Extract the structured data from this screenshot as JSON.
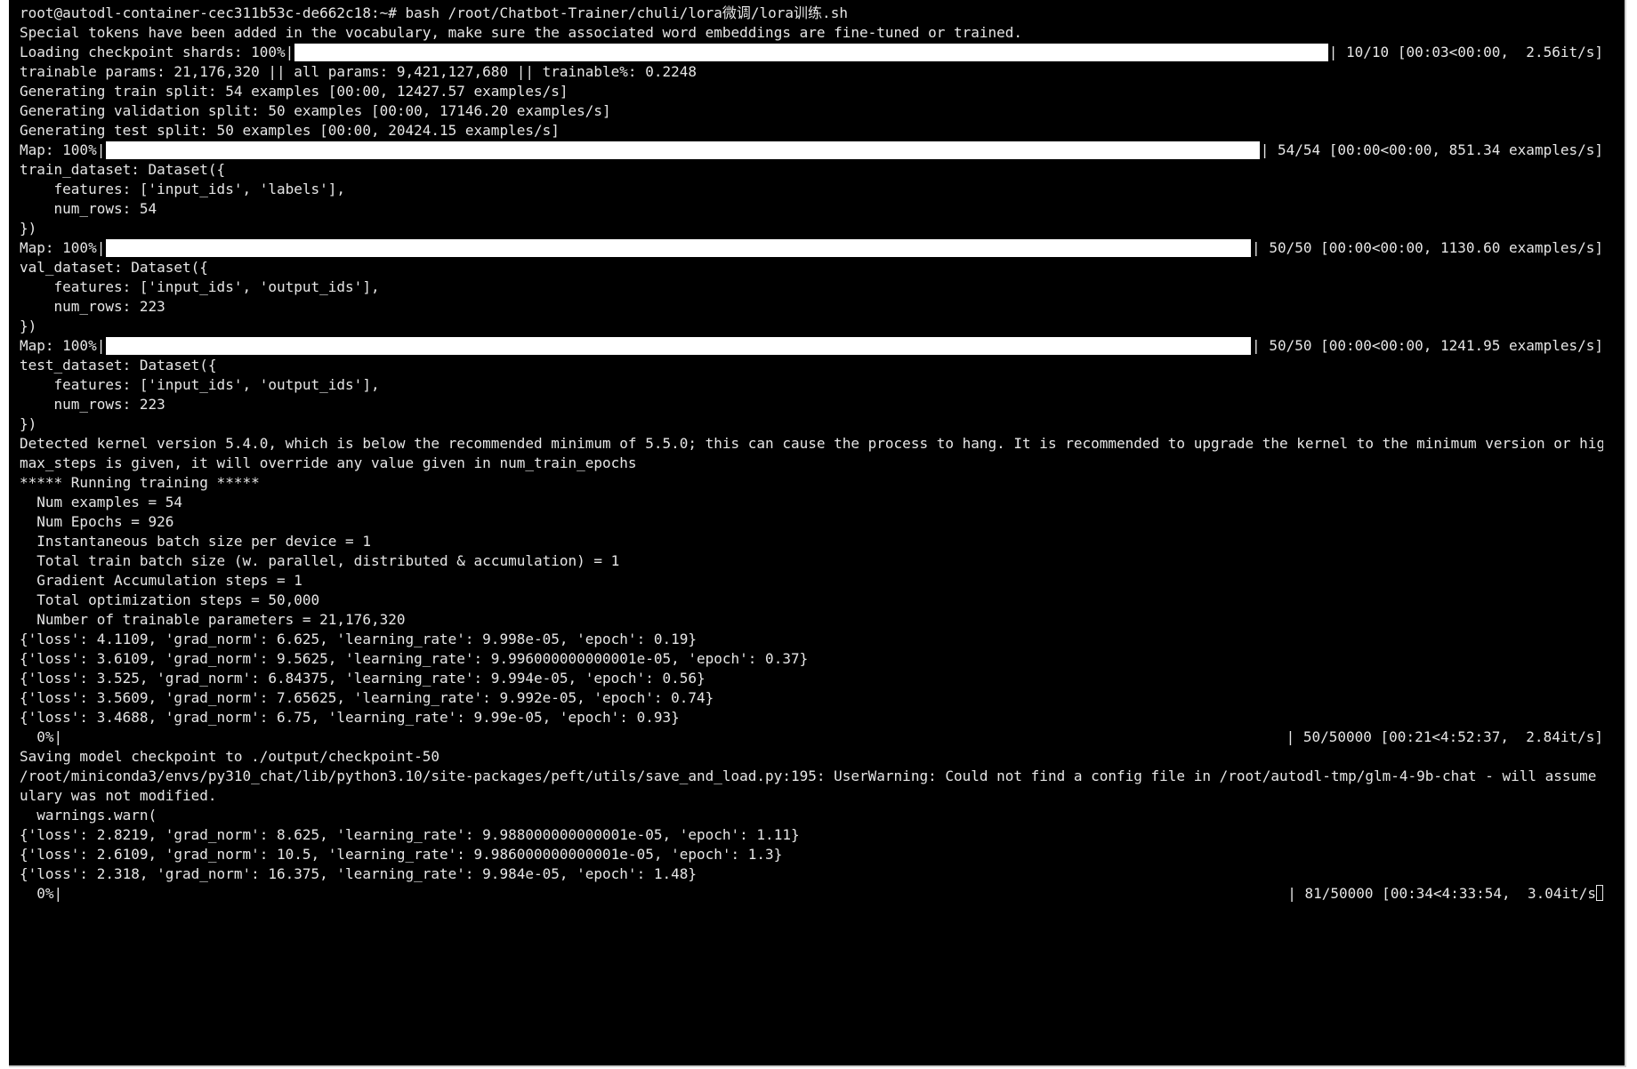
{
  "prompt": "root@autodl-container-cec311b53c-de662c18:~# bash /root/Chatbot-Trainer/chuli/lora微调/lora训练.sh",
  "lines_a": [
    "Special tokens have been added in the vocabulary, make sure the associated word embeddings are fine-tuned or trained."
  ],
  "progress_shards": {
    "prefix": "Loading checkpoint shards: 100%|",
    "fill": 1.0,
    "suffix": "| 10/10 [00:03<00:00,  2.56it/s]"
  },
  "lines_b": [
    "trainable params: 21,176,320 || all params: 9,421,127,680 || trainable%: 0.2248",
    "Generating train split: 54 examples [00:00, 12427.57 examples/s]",
    "Generating validation split: 50 examples [00:00, 17146.20 examples/s]",
    "Generating test split: 50 examples [00:00, 20424.15 examples/s]"
  ],
  "progress_map1": {
    "prefix": "Map: 100%|",
    "fill": 1.0,
    "suffix": "| 54/54 [00:00<00:00, 851.34 examples/s]"
  },
  "lines_c": [
    "train_dataset: Dataset({",
    "    features: ['input_ids', 'labels'],",
    "    num_rows: 54",
    "})"
  ],
  "progress_map2": {
    "prefix": "Map: 100%|",
    "fill": 1.0,
    "suffix": "| 50/50 [00:00<00:00, 1130.60 examples/s]"
  },
  "lines_d": [
    "val_dataset: Dataset({",
    "    features: ['input_ids', 'output_ids'],",
    "    num_rows: 223",
    "})"
  ],
  "progress_map3": {
    "prefix": "Map: 100%|",
    "fill": 1.0,
    "suffix": "| 50/50 [00:00<00:00, 1241.95 examples/s]"
  },
  "lines_e": [
    "test_dataset: Dataset({",
    "    features: ['input_ids', 'output_ids'],",
    "    num_rows: 223",
    "})",
    "Detected kernel version 5.4.0, which is below the recommended minimum of 5.5.0; this can cause the process to hang. It is recommended to upgrade the kernel to the minimum version or higher.",
    "max_steps is given, it will override any value given in num_train_epochs",
    "***** Running training *****",
    "  Num examples = 54",
    "  Num Epochs = 926",
    "  Instantaneous batch size per device = 1",
    "  Total train batch size (w. parallel, distributed & accumulation) = 1",
    "  Gradient Accumulation steps = 1",
    "  Total optimization steps = 50,000",
    "  Number of trainable parameters = 21,176,320",
    "{'loss': 4.1109, 'grad_norm': 6.625, 'learning_rate': 9.998e-05, 'epoch': 0.19}",
    "{'loss': 3.6109, 'grad_norm': 9.5625, 'learning_rate': 9.996000000000001e-05, 'epoch': 0.37}",
    "{'loss': 3.525, 'grad_norm': 6.84375, 'learning_rate': 9.994e-05, 'epoch': 0.56}",
    "{'loss': 3.5609, 'grad_norm': 7.65625, 'learning_rate': 9.992e-05, 'epoch': 0.74}",
    "{'loss': 3.4688, 'grad_norm': 6.75, 'learning_rate': 9.99e-05, 'epoch': 0.93}"
  ],
  "progress_train1": {
    "prefix": "  0%|",
    "fill": 0.0,
    "suffix": "| 50/50000 [00:21<4:52:37,  2.84it/s]"
  },
  "lines_f": [
    "Saving model checkpoint to ./output/checkpoint-50",
    "/root/miniconda3/envs/py310_chat/lib/python3.10/site-packages/peft/utils/save_and_load.py:195: UserWarning: Could not find a config file in /root/autodl-tmp/glm-4-9b-chat - will assume that the vocab",
    "ulary was not modified.",
    "  warnings.warn(",
    "{'loss': 2.8219, 'grad_norm': 8.625, 'learning_rate': 9.988000000000001e-05, 'epoch': 1.11}",
    "{'loss': 2.6109, 'grad_norm': 10.5, 'learning_rate': 9.986000000000001e-05, 'epoch': 1.3}",
    "{'loss': 2.318, 'grad_norm': 16.375, 'learning_rate': 9.984e-05, 'epoch': 1.48}"
  ],
  "progress_train2": {
    "prefix": "  0%|",
    "fill": 0.0,
    "suffix": "| 81/50000 [00:34<4:33:54,  3.04it/s"
  },
  "colors": {
    "background": "#000000",
    "foreground": "#e6e6e6",
    "bar": "#ffffff"
  }
}
